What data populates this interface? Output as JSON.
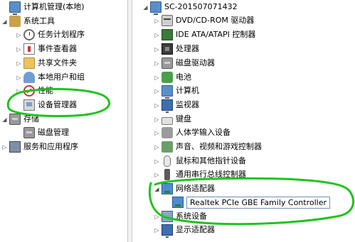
{
  "left_tree": {
    "items": [
      {
        "label": "计算机管理(本地)",
        "toggle": "",
        "icon": "computer-management-icon"
      },
      {
        "label": "系统工具",
        "toggle": "◢",
        "icon": "system-tools-icon"
      },
      {
        "label": "任务计划程序",
        "toggle": "▷",
        "icon": "task-scheduler-icon"
      },
      {
        "label": "事件查看器",
        "toggle": "▷",
        "icon": "event-viewer-icon"
      },
      {
        "label": "共享文件夹",
        "toggle": "▷",
        "icon": "shared-folders-icon"
      },
      {
        "label": "本地用户和组",
        "toggle": "▷",
        "icon": "local-users-icon"
      },
      {
        "label": "性能",
        "toggle": "▷",
        "icon": "performance-icon"
      },
      {
        "label": "设备管理器",
        "toggle": "",
        "icon": "device-manager-icon"
      },
      {
        "label": "存储",
        "toggle": "◢",
        "icon": "storage-icon"
      },
      {
        "label": "磁盘管理",
        "toggle": "",
        "icon": "disk-management-icon"
      },
      {
        "label": "服务和应用程序",
        "toggle": "▷",
        "icon": "services-apps-icon"
      }
    ]
  },
  "device_tree": {
    "root": {
      "label": "SC-201507071432",
      "toggle": "◢",
      "icon": "computer-icon"
    },
    "categories": [
      {
        "label": "DVD/CD-ROM 驱动器",
        "icon": "dvd-drive-icon"
      },
      {
        "label": "IDE ATA/ATAPI 控制器",
        "icon": "ide-controller-icon"
      },
      {
        "label": "处理器",
        "icon": "processor-icon"
      },
      {
        "label": "磁盘驱动器",
        "icon": "disk-drive-icon"
      },
      {
        "label": "电池",
        "icon": "battery-icon"
      },
      {
        "label": "计算机",
        "icon": "computer-icon"
      },
      {
        "label": "监视器",
        "icon": "monitor-icon"
      },
      {
        "label": "键盘",
        "icon": "keyboard-icon"
      },
      {
        "label": "人体学输入设备",
        "icon": "hid-icon"
      },
      {
        "label": "声音、视频和游戏控制器",
        "icon": "sound-video-icon"
      },
      {
        "label": "鼠标和其他指针设备",
        "icon": "mouse-icon"
      },
      {
        "label": "通用串行总线控制器",
        "icon": "usb-controller-icon"
      },
      {
        "label": "网络适配器",
        "icon": "network-adapter-icon"
      },
      {
        "label": "Realtek PCIe GBE Family Controller",
        "icon": "network-card-icon"
      },
      {
        "label": "系统设备",
        "icon": "system-devices-icon"
      },
      {
        "label": "显示适配器",
        "icon": "display-adapter-icon"
      }
    ],
    "collapsed_toggle": "▷",
    "expanded_toggle": "◢"
  },
  "colors": {
    "annotation_green": "#1ec41e",
    "selection_border": "#6f8ec0"
  }
}
